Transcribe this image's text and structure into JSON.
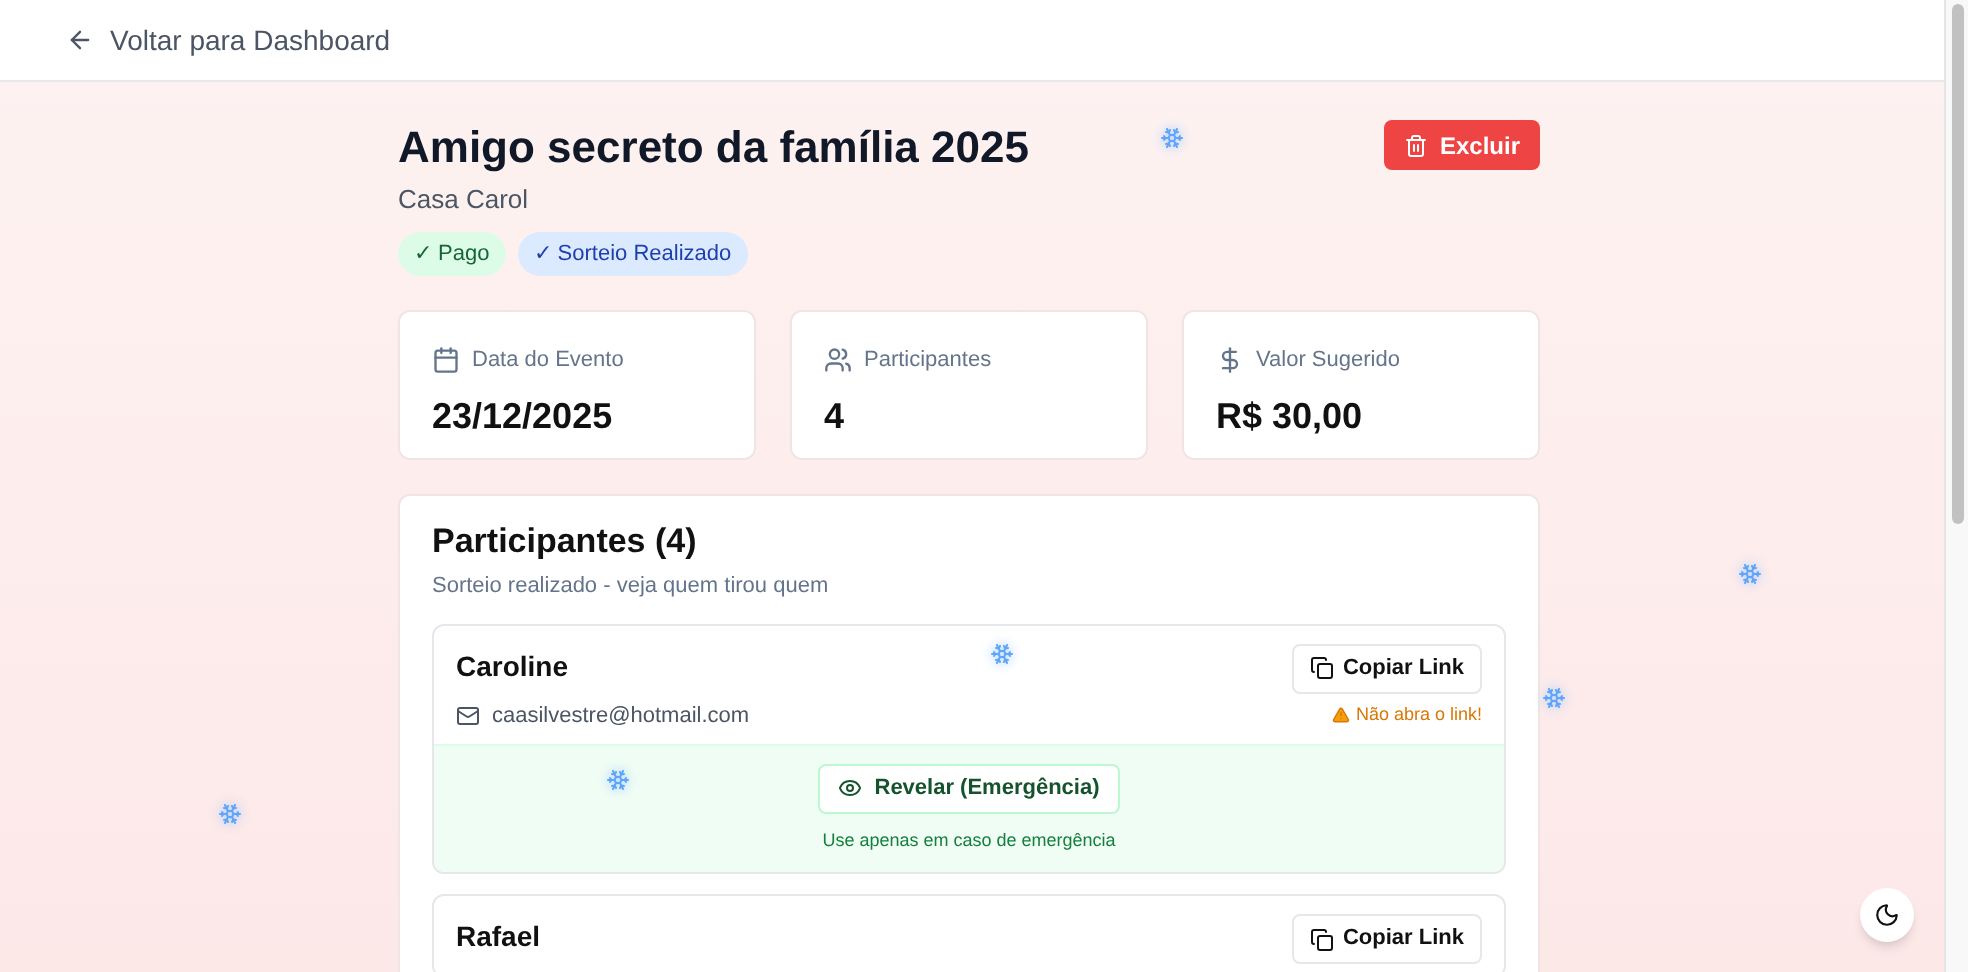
{
  "nav": {
    "back_label": "Voltar para Dashboard"
  },
  "event": {
    "title": "Amigo secreto da família 2025",
    "location": "Casa Carol",
    "delete_label": "Excluir"
  },
  "badges": [
    {
      "label": "✓ Pago",
      "kind": "success"
    },
    {
      "label": "✓ Sorteio Realizado",
      "kind": "info"
    }
  ],
  "stats": [
    {
      "kind": "date",
      "label": "Data do Evento",
      "value": "23/12/2025"
    },
    {
      "kind": "people",
      "label": "Participantes",
      "value": "4"
    },
    {
      "kind": "money",
      "label": "Valor Sugerido",
      "value": "R$ 30,00"
    }
  ],
  "participants_panel": {
    "title": "Participantes (4)",
    "subtitle": "Sorteio realizado - veja quem tirou quem",
    "participants": [
      {
        "name": "Caroline",
        "email": "caasilvestre@hotmail.com",
        "copy_label": "Copiar Link",
        "warning": "Não abra o link!",
        "reveal_label": "Revelar (Emergência)",
        "reveal_note": "Use apenas em caso de emergência"
      },
      {
        "name": "Rafael",
        "copy_label": "Copiar Link"
      }
    ]
  }
}
